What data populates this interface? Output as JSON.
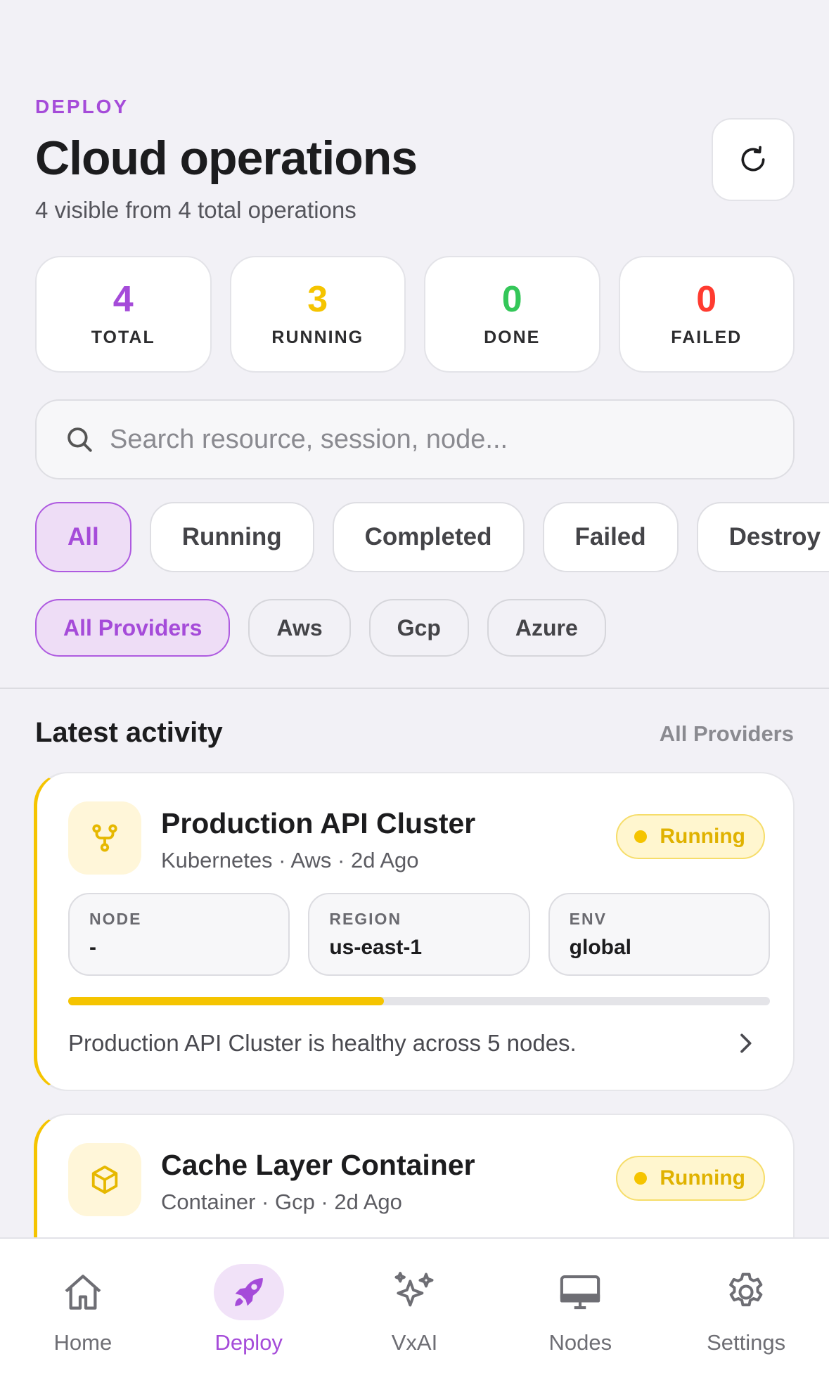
{
  "header": {
    "eyebrow": "DEPLOY",
    "title": "Cloud operations",
    "subtitle": "4 visible from 4 total operations"
  },
  "stats": [
    {
      "value": "4",
      "label": "TOTAL",
      "color": "#a54bd9"
    },
    {
      "value": "3",
      "label": "RUNNING",
      "color": "#f5c400"
    },
    {
      "value": "0",
      "label": "DONE",
      "color": "#34c759"
    },
    {
      "value": "0",
      "label": "FAILED",
      "color": "#ff3b30"
    }
  ],
  "search": {
    "placeholder": "Search resource, session, node...",
    "value": ""
  },
  "status_filters": [
    {
      "label": "All",
      "active": true
    },
    {
      "label": "Running",
      "active": false
    },
    {
      "label": "Completed",
      "active": false
    },
    {
      "label": "Failed",
      "active": false
    },
    {
      "label": "Destroy",
      "active": false
    }
  ],
  "provider_filters": [
    {
      "label": "All Providers",
      "active": true
    },
    {
      "label": "Aws",
      "active": false
    },
    {
      "label": "Gcp",
      "active": false
    },
    {
      "label": "Azure",
      "active": false
    }
  ],
  "activity": {
    "title": "Latest activity",
    "filter_label": "All Providers",
    "items": [
      {
        "title": "Production API Cluster",
        "meta": "Kubernetes · Aws · 2d Ago",
        "status": "Running",
        "icon": "kubernetes-fork-icon",
        "node_label": "NODE",
        "node_value": "-",
        "region_label": "REGION",
        "region_value": "us-east-1",
        "env_label": "ENV",
        "env_value": "global",
        "progress": 0.45,
        "description": "Production API Cluster is healthy across 5 nodes."
      },
      {
        "title": "Cache Layer Container",
        "meta": "Container · Gcp · 2d Ago",
        "status": "Running",
        "icon": "container-cube-icon"
      }
    ]
  },
  "tabbar": [
    {
      "label": "Home",
      "icon": "home-icon",
      "active": false
    },
    {
      "label": "Deploy",
      "icon": "rocket-icon",
      "active": true
    },
    {
      "label": "VxAI",
      "icon": "sparkles-icon",
      "active": false
    },
    {
      "label": "Nodes",
      "icon": "monitor-icon",
      "active": false
    },
    {
      "label": "Settings",
      "icon": "gear-icon",
      "active": false
    }
  ],
  "colors": {
    "accent": "#a54bd9",
    "running": "#f5c400",
    "done": "#34c759",
    "failed": "#ff3b30"
  }
}
